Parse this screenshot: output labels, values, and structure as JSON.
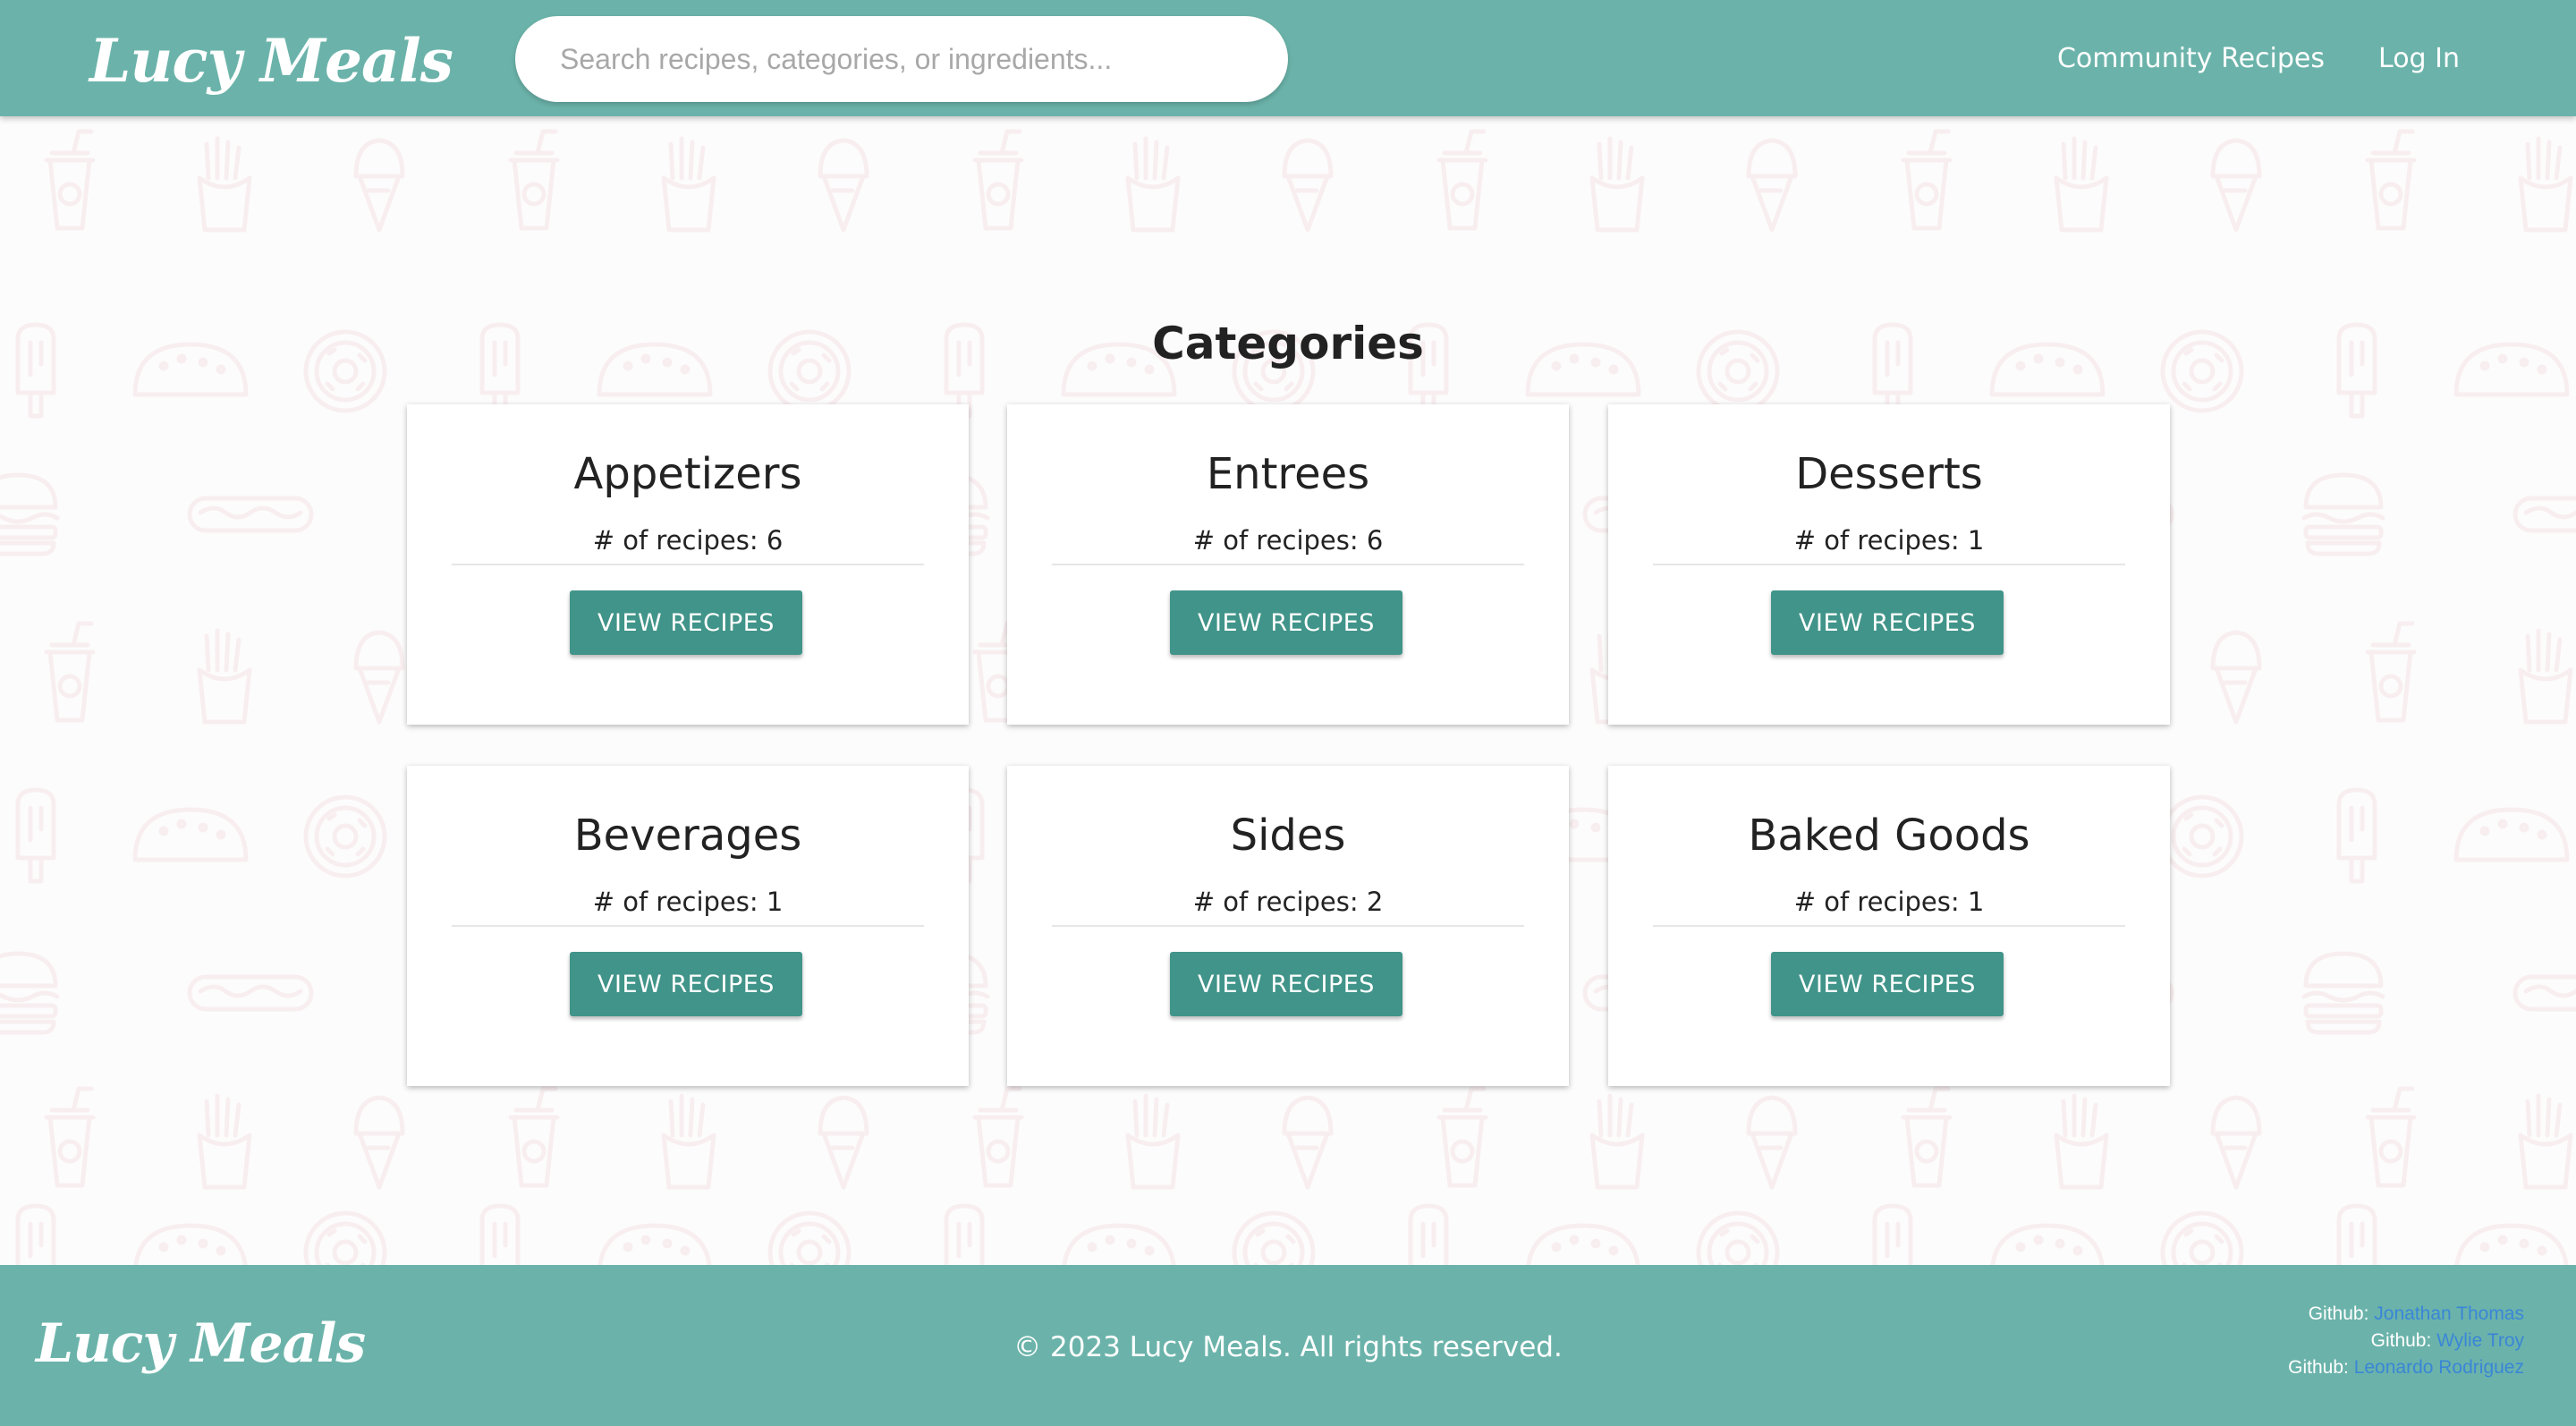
{
  "header": {
    "brand": "Lucy Meals",
    "search_placeholder": "Search recipes, categories, or ingredients...",
    "nav": {
      "community": "Community Recipes",
      "login": "Log In"
    }
  },
  "main": {
    "title": "Categories",
    "categories": [
      {
        "name": "Appetizers",
        "count_text": "# of recipes: 6",
        "button": "VIEW RECIPES"
      },
      {
        "name": "Entrees",
        "count_text": "# of recipes: 6",
        "button": "VIEW RECIPES"
      },
      {
        "name": "Desserts",
        "count_text": "# of recipes: 1",
        "button": "VIEW RECIPES"
      },
      {
        "name": "Beverages",
        "count_text": "# of recipes: 1",
        "button": "VIEW RECIPES"
      },
      {
        "name": "Sides",
        "count_text": "# of recipes: 2",
        "button": "VIEW RECIPES"
      },
      {
        "name": "Baked Goods",
        "count_text": "# of recipes: 1",
        "button": "VIEW RECIPES"
      }
    ]
  },
  "footer": {
    "brand": "Lucy Meals",
    "copyright": "© 2023 Lucy Meals. All rights reserved.",
    "credits": [
      {
        "label": "Github:",
        "name": "Jonathan Thomas"
      },
      {
        "label": "Github:",
        "name": "Wylie Troy"
      },
      {
        "label": "Github:",
        "name": "Leonardo Rodriguez"
      }
    ]
  },
  "theme": {
    "header_bg": "#6bb3aa",
    "button_bg": "#419489",
    "link_color": "#3a86d6",
    "pattern_color": "#e9a9b8"
  },
  "background_icons": [
    "soda-cup-icon",
    "ice-cream-cone-icon",
    "fries-icon",
    "popsicle-icon",
    "taco-icon",
    "donut-icon",
    "hot-dog-icon",
    "burger-icon"
  ]
}
